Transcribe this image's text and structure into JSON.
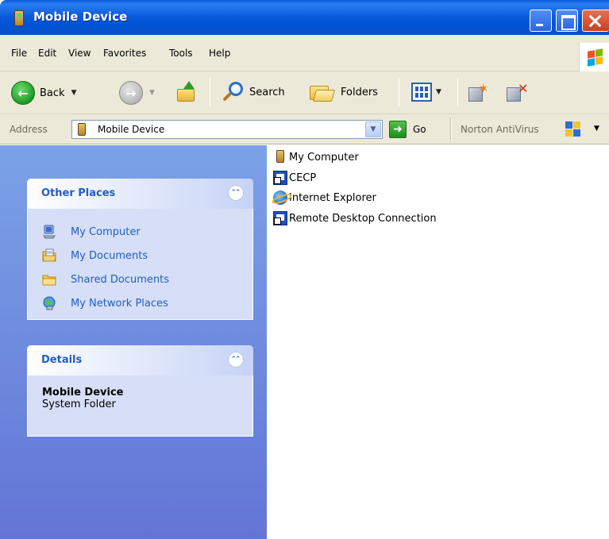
{
  "window": {
    "title": "Mobile Device"
  },
  "menu": {
    "items": [
      {
        "label": "File"
      },
      {
        "label": "Edit"
      },
      {
        "label": "View"
      },
      {
        "label": "Favorites"
      },
      {
        "label": "Tools"
      },
      {
        "label": "Help"
      }
    ]
  },
  "toolbar": {
    "back_label": "Back",
    "search_label": "Search",
    "folders_label": "Folders"
  },
  "address": {
    "label": "Address",
    "value": "Mobile Device",
    "go_label": "Go",
    "norton_label": "Norton AntiVirus"
  },
  "sidebar": {
    "other_places": {
      "title": "Other Places",
      "items": [
        {
          "label": "My Computer",
          "icon": "computer-icon"
        },
        {
          "label": "My Documents",
          "icon": "documents-icon"
        },
        {
          "label": "Shared Documents",
          "icon": "folder-icon"
        },
        {
          "label": "My Network Places",
          "icon": "network-icon"
        }
      ]
    },
    "details": {
      "title": "Details",
      "name": "Mobile Device",
      "type": "System Folder"
    }
  },
  "files": [
    {
      "name": "My Computer",
      "icon": "mobile-device-icon"
    },
    {
      "name": "CECP",
      "icon": "shortcut-icon"
    },
    {
      "name": "Internet Explorer",
      "icon": "internet-explorer-icon"
    },
    {
      "name": "Remote Desktop Connection",
      "icon": "shortcut-icon"
    }
  ],
  "colors": {
    "titlebar": "#0a5cdc",
    "taskpane_top": "#7ba2e7",
    "taskpane_bottom": "#6375d6",
    "link": "#215dc6",
    "chrome": "#ece9d8"
  }
}
